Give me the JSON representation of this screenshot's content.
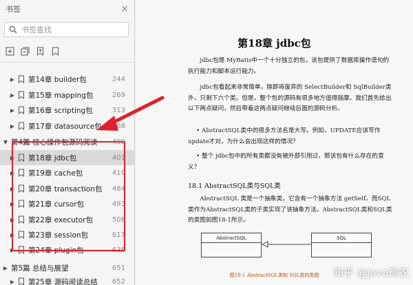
{
  "sidebar": {
    "title": "书签",
    "close_glyph": "×",
    "search_placeholder": "书签查找",
    "tools": [
      "add-bookmark-icon",
      "expand-all-icon",
      "bookmark-icon",
      "bookmark-outline-icon"
    ],
    "items": [
      {
        "level": 1,
        "arrow": "▶",
        "label": "第14章 builder包",
        "page": "244"
      },
      {
        "level": 1,
        "arrow": "▶",
        "label": "第15章 mapping包",
        "page": "269"
      },
      {
        "level": 1,
        "arrow": "▶",
        "label": "第16章 scripting包",
        "page": "313"
      },
      {
        "level": 1,
        "arrow": "▶",
        "label": "第17章 datasource包",
        "page": "368"
      },
      {
        "level": 0,
        "arrow": "▼",
        "label": "第4篇 核心操作包源码阅读",
        "page": "400"
      },
      {
        "level": 1,
        "arrow": "▶",
        "label": "第18章 jdbc包",
        "page": "401",
        "selected": true
      },
      {
        "level": 1,
        "arrow": "▶",
        "label": "第19章 cache包",
        "page": "419"
      },
      {
        "level": 1,
        "arrow": "▶",
        "label": "第20章 transaction包",
        "page": "484"
      },
      {
        "level": 1,
        "arrow": "▶",
        "label": "第21章 cursor包",
        "page": "493"
      },
      {
        "level": 1,
        "arrow": "▶",
        "label": "第22章 executor包",
        "page": "508"
      },
      {
        "level": 1,
        "arrow": "▶",
        "label": "第23章 session包",
        "page": "617"
      },
      {
        "level": 1,
        "arrow": "▶",
        "label": "第24章 plugin包",
        "page": "635"
      },
      {
        "level": 0,
        "arrow": "▶",
        "label": "第5篇 总结与展望",
        "page": "651"
      },
      {
        "level": 1,
        "arrow": "▶",
        "label": "第25章 源码阅读总结",
        "page": "652"
      }
    ]
  },
  "document": {
    "chapter_title": "第18章 jdbc包",
    "para1": "jdbc包是 MyBatis中一个十分独立的包，该包提供了数据库操作语句的执行能力和脚本运行能力。",
    "para2": "jdbc包看起来非常简单，除即将废弃的 SelectBuilder和 SqlBuilder类外，只剩下六个类。但是，整个包的源码有很多地方值得揣摩。我们首先给出以下两点疑问，然后带着这两点疑问继续后面的源码分析。",
    "bullet1": "• AbstractSQL类中的很多方法名是大写。例如，UPDATE应该写作update才对，为什么会出现这样的情况？",
    "bullet2": "• 整个 jdbc包中的所有类都没有被外部引用过，那该包有什么存在的意义？",
    "section_title": "18.1 AbstractSQL类与SQL类",
    "para3": "AbstractSQL 类是一个抽象类，它含有一个抽象方法 getSelf。而SQL 类作为AbstractSQL类的子类实现了该抽象方法。AbstractSQL类和SQL类的类图如图18-1所示。",
    "diagram_left": "AbstractSQL",
    "diagram_right": "SQL",
    "figure_caption": "图18-1 AbstractSQL类和 SQL类的类图",
    "watermark": "知乎 @Java码农"
  },
  "colors": {
    "highlight": "#e0202a",
    "selected_row": "#d9d9d9",
    "caption": "#b0521e"
  }
}
